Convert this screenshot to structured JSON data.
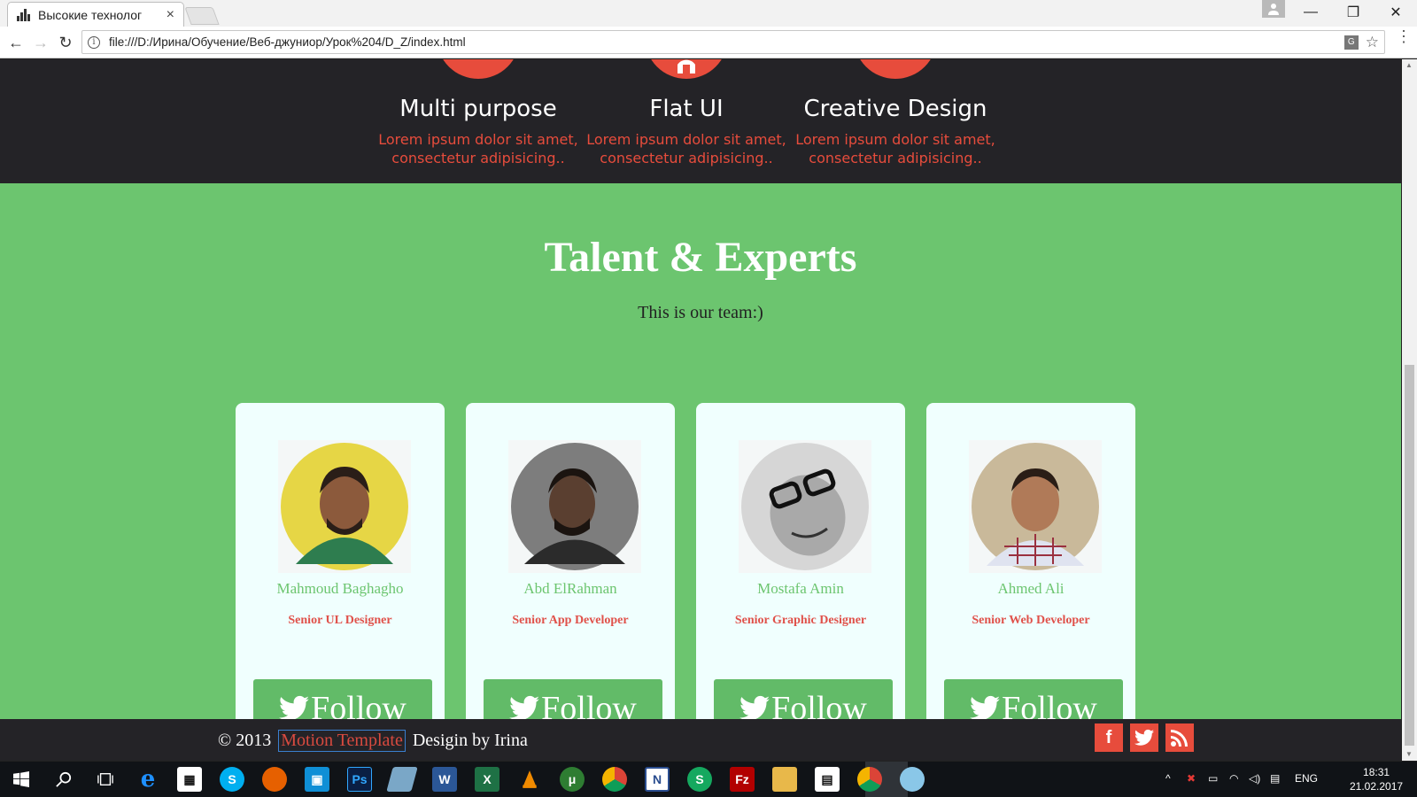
{
  "browser": {
    "tab_title": "Высокие технолог",
    "tab_close": "×",
    "url": "file:///D:/Ирина/Обучение/Веб-джуниор/Урок%204/D_Z/index.html",
    "back": "←",
    "forward": "→",
    "reload": "↻",
    "info": "i",
    "translate": "G",
    "star": "☆",
    "menu": "⋮",
    "minimize": "—",
    "restore": "❐",
    "close": "✕"
  },
  "features": [
    {
      "title": "Multi purpose",
      "text": "Lorem ipsum dolor sit amet, consectetur adipisicing.."
    },
    {
      "title": "Flat UI",
      "text": "Lorem ipsum dolor sit amet, consectetur adipisicing.."
    },
    {
      "title": "Creative Design",
      "text": "Lorem ipsum dolor sit amet, consectetur adipisicing.."
    }
  ],
  "team": {
    "title": "Talent & Experts",
    "subtitle": "This is our team:)",
    "follow_label": "Follow",
    "members": [
      {
        "name": "Mahmoud Baghagho",
        "role": "Senior UL Designer",
        "photo_bg": "#e6d645"
      },
      {
        "name": "Abd ElRahman",
        "role": "Senior App Developer",
        "photo_bg": "#8a8a8a"
      },
      {
        "name": "Mostafa Amin",
        "role": "Senior Graphic Designer",
        "photo_bg": "#cfcfcf"
      },
      {
        "name": "Ahmed Ali",
        "role": "Senior Web Developer",
        "photo_bg": "#c9b99a"
      }
    ]
  },
  "footer": {
    "copyright": "© 2013",
    "link": "Motion Template",
    "credit": "Desigin by Irina",
    "social": [
      "facebook-icon",
      "twitter-icon",
      "rss-icon"
    ]
  },
  "taskbar": {
    "lang": "ENG",
    "time": "18:31",
    "date": "21.02.2017"
  },
  "colors": {
    "accent_red": "#e74c3c",
    "green": "#6cc56f",
    "dark": "#242327"
  }
}
